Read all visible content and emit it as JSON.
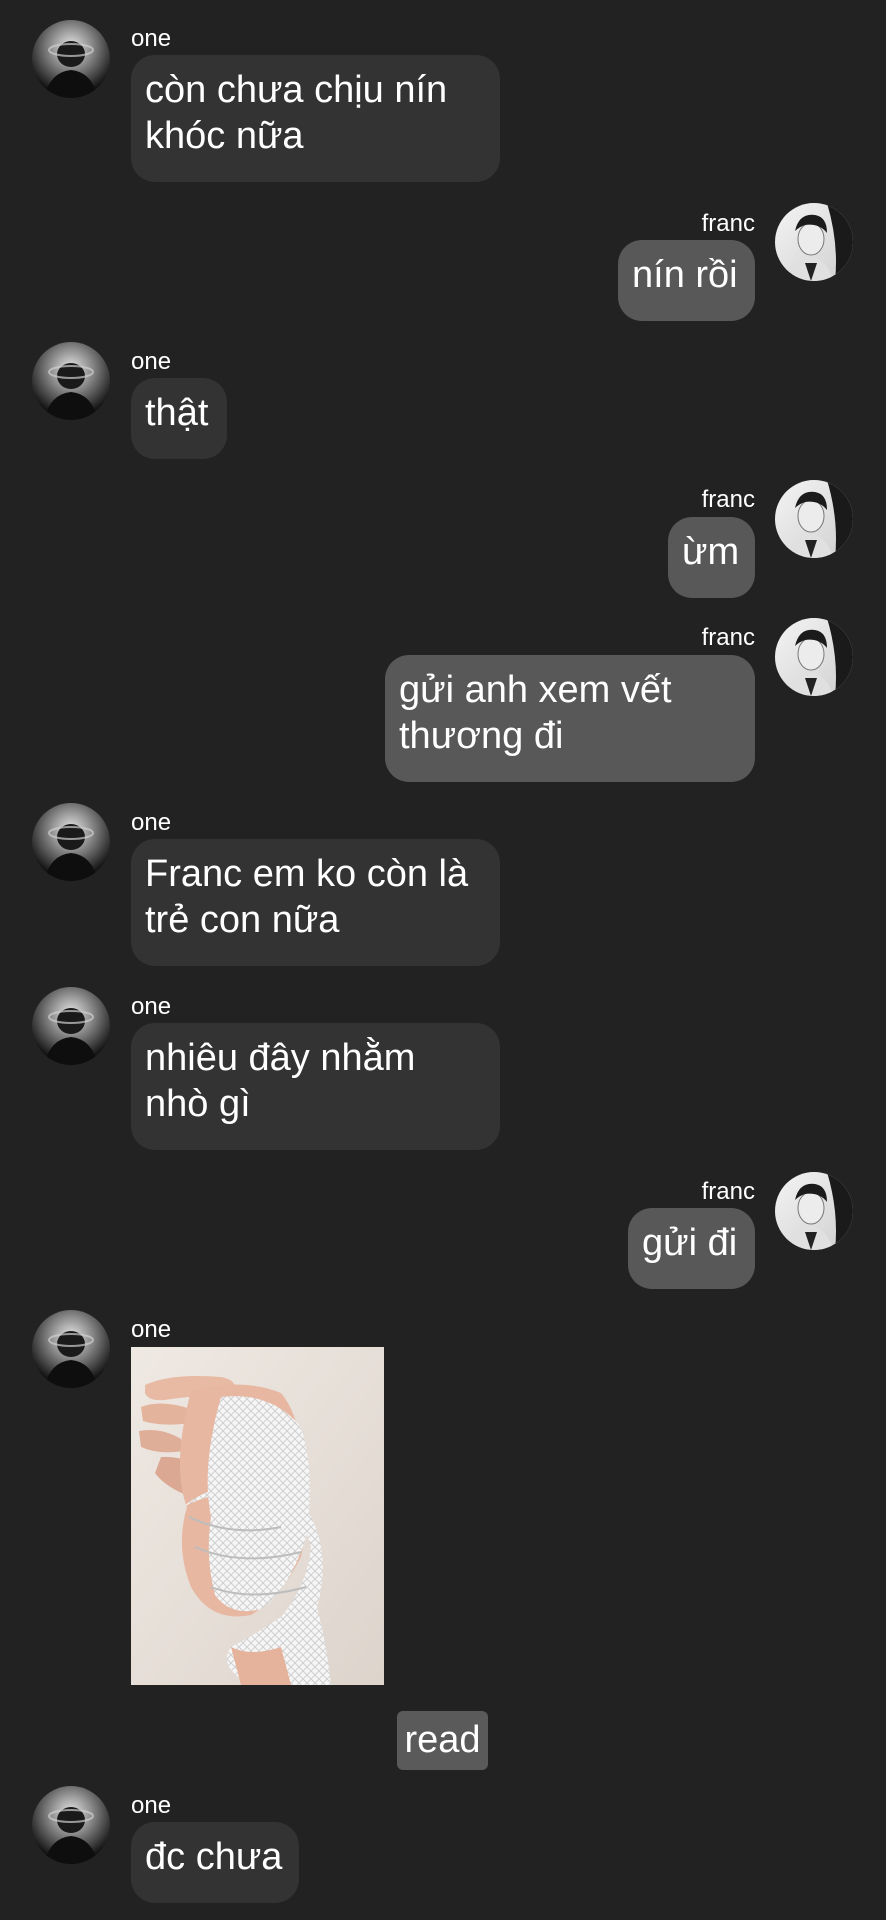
{
  "chat": {
    "messages": [
      {
        "sender": "one",
        "lines": [
          "còn chưa chịu nín",
          "khóc nữa"
        ]
      },
      {
        "sender": "franc",
        "lines": [
          "nín rồi"
        ]
      },
      {
        "sender": "one",
        "lines": [
          "thật"
        ]
      },
      {
        "sender": "franc",
        "lines": [
          "ừm"
        ]
      },
      {
        "sender": "franc",
        "lines": [
          "gửi anh xem vết",
          "thương đi"
        ]
      },
      {
        "sender": "one",
        "lines": [
          "Franc em ko còn là",
          "trẻ con nữa"
        ]
      },
      {
        "sender": "one",
        "lines": [
          "nhiêu đây nhằm",
          "nhò gì"
        ]
      },
      {
        "sender": "franc",
        "lines": [
          "gửi đi"
        ]
      },
      {
        "sender": "one",
        "image": "bandaged-hand-photo"
      },
      {
        "sender": "one",
        "lines": [
          "đc chưa"
        ]
      }
    ],
    "read_label": "read"
  },
  "colors": {
    "background": "#222222",
    "incoming_bubble": "#333333",
    "outgoing_bubble": "#585858",
    "read_badge": "#5a5a5a",
    "text": "#ffffff"
  },
  "icons": {
    "one_avatar": "profile-photo-one",
    "franc_avatar": "profile-photo-franc"
  }
}
